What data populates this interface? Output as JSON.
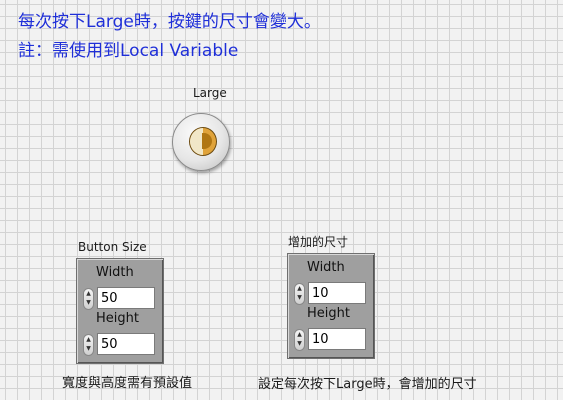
{
  "description": {
    "line1": "每次按下Large時，按鍵的尺寸會變大。",
    "line2": "註：需使用到Local Variable"
  },
  "large_button": {
    "label": "Large",
    "state": "off"
  },
  "button_size": {
    "label": "Button Size",
    "width_label": "Width",
    "width_value": "50",
    "height_label": "Height",
    "height_value": "50",
    "caption": "寬度與高度需有預設值"
  },
  "increment": {
    "label": "增加的尺寸",
    "width_label": "Width",
    "width_value": "10",
    "height_label": "Height",
    "height_value": "10",
    "caption": "設定每次按下Large時，會增加的尺寸"
  },
  "colors": {
    "accent": "#1f2fd8",
    "led": "#e0a33a"
  }
}
